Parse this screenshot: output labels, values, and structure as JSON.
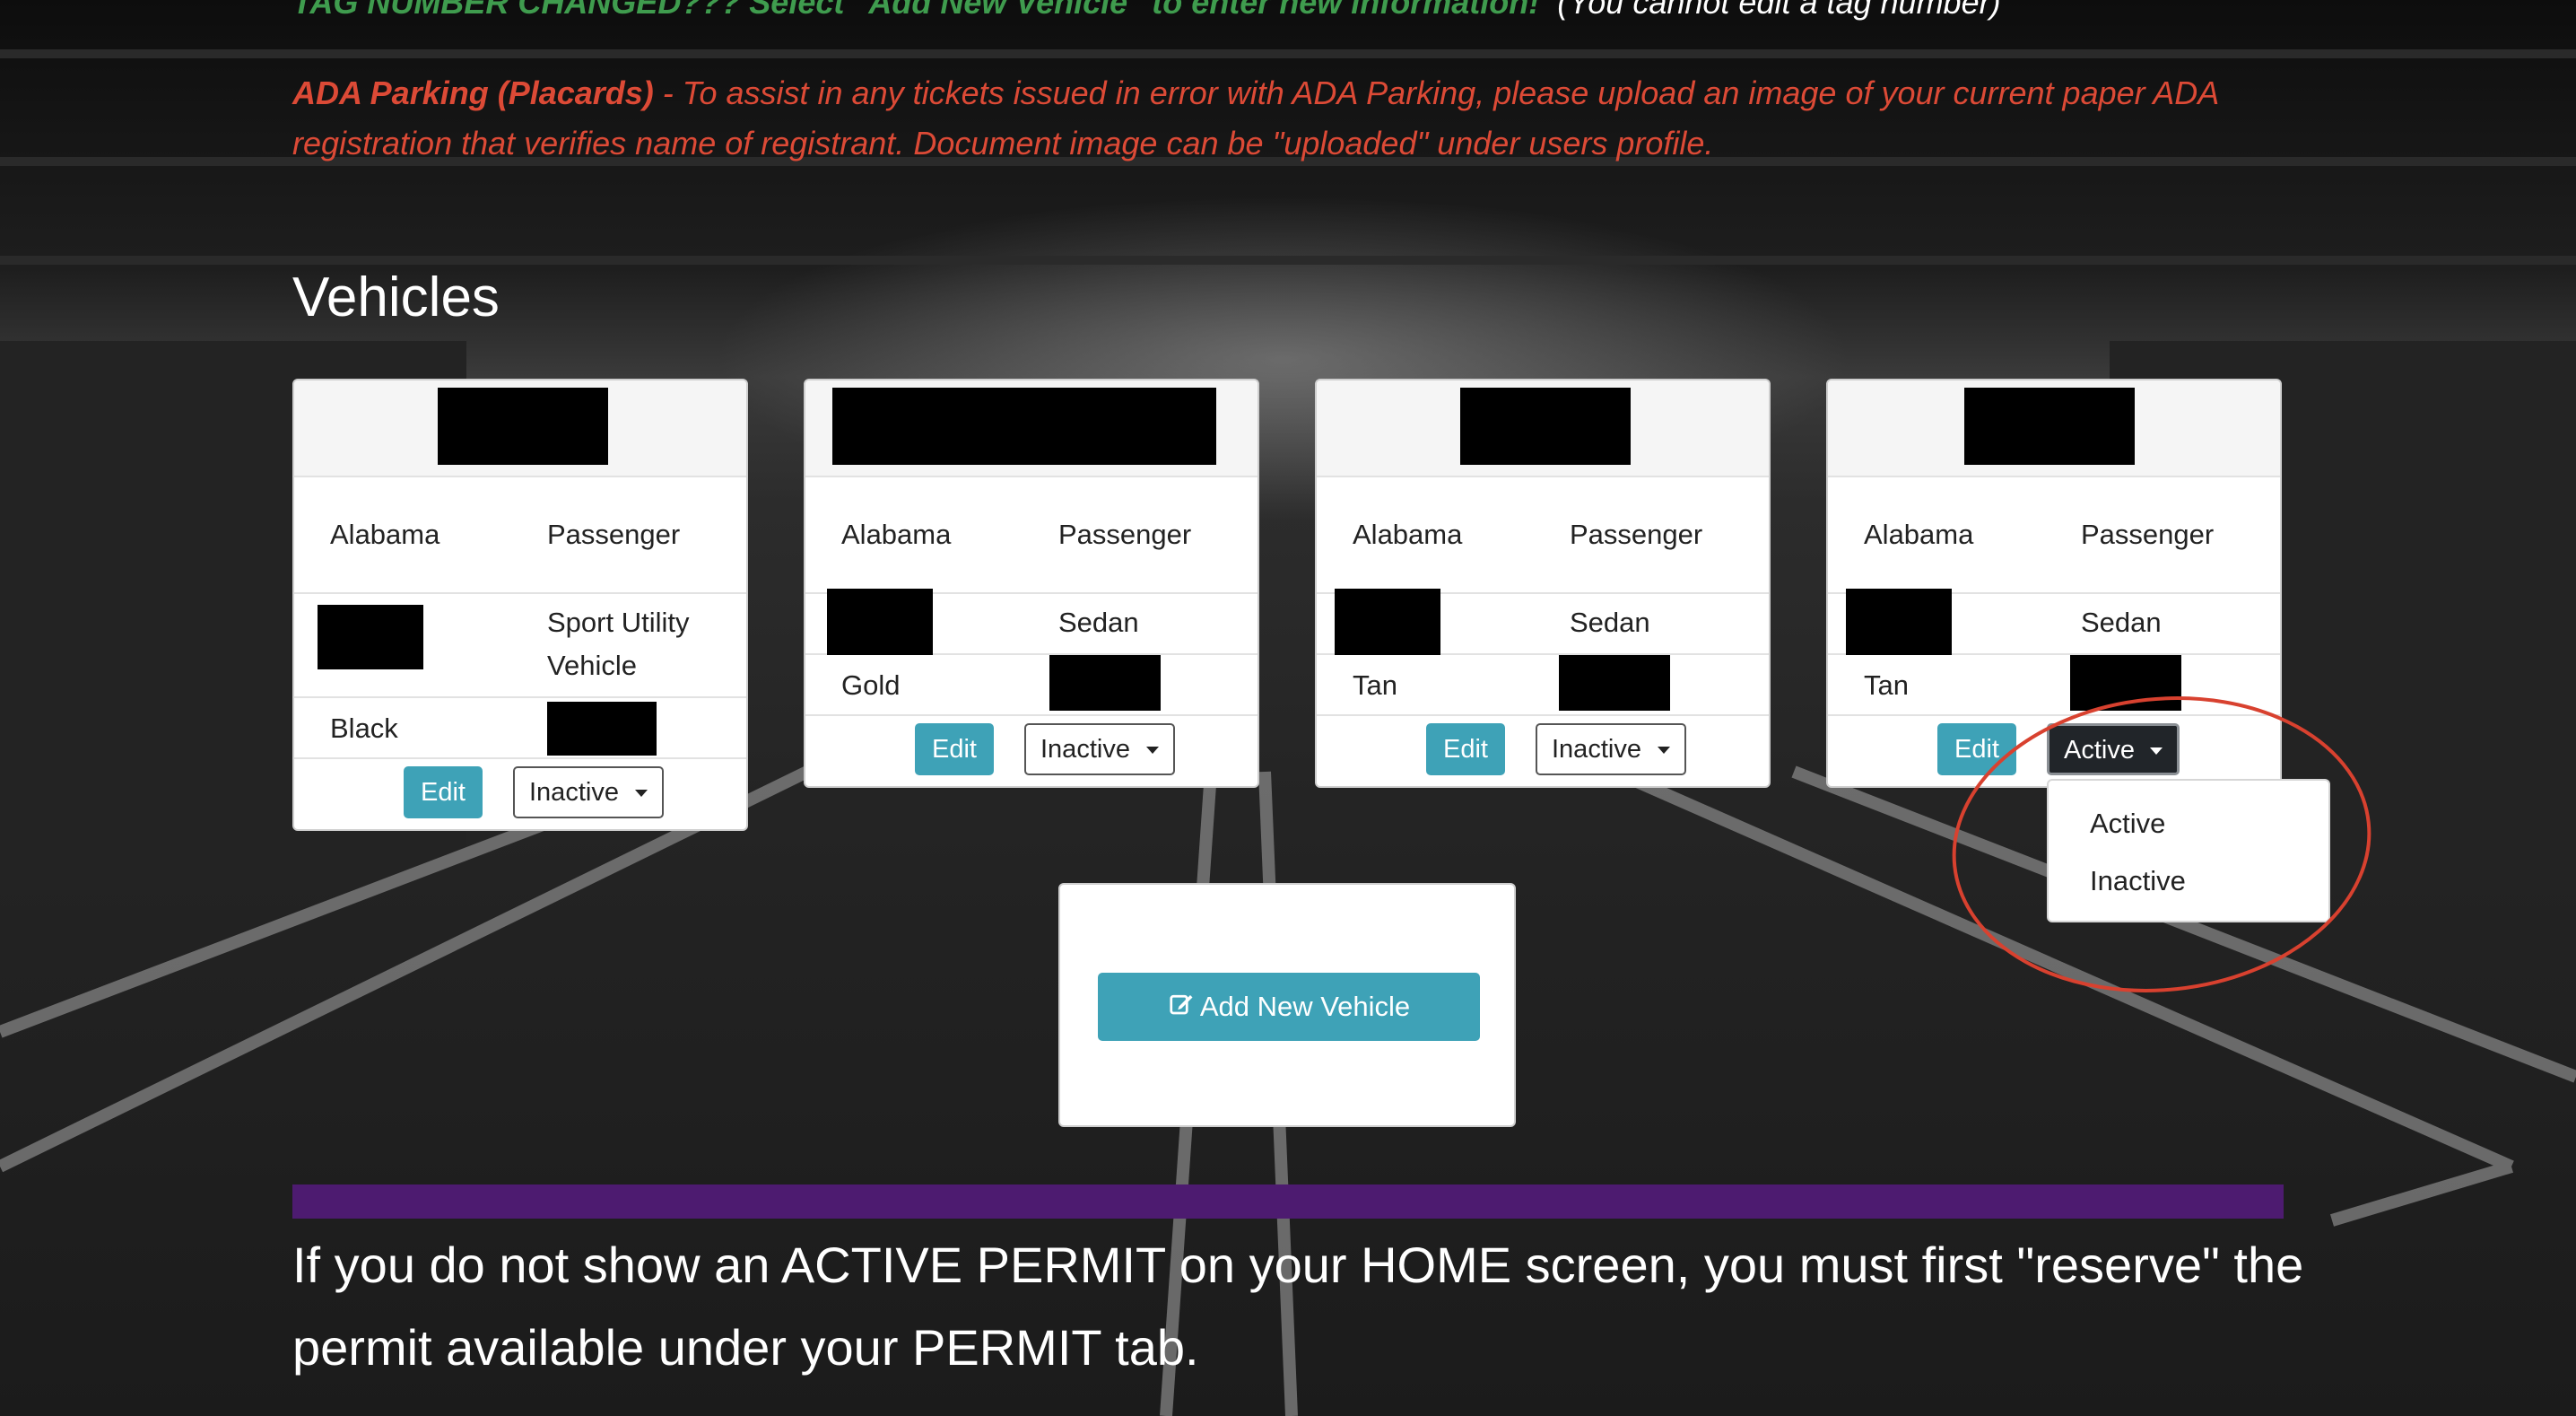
{
  "notices": {
    "tag_changed": "TAG NUMBER CHANGED???  Select \"Add New Vehicle\" to enter new information!",
    "tag_note": "(You cannot edit a tag number)",
    "ada_lead": "ADA Parking (Placards)",
    "ada_body": " - To assist in any tickets issued in error with ADA Parking, please upload an image of your current paper ADA registration that verifies name of registrant.  Document image can be \"uploaded\" under users profile."
  },
  "vehicles_section": {
    "title": "Vehicles",
    "cards": [
      {
        "state": "Alabama",
        "class": "Passenger",
        "type": "Sport Utility Vehicle",
        "color": "Black",
        "edit_label": "Edit",
        "status": "Inactive"
      },
      {
        "state": "Alabama",
        "class": "Passenger",
        "type": "Sedan",
        "color": "Gold",
        "edit_label": "Edit",
        "status": "Inactive"
      },
      {
        "state": "Alabama",
        "class": "Passenger",
        "type": "Sedan",
        "color": "Tan",
        "edit_label": "Edit",
        "status": "Inactive"
      },
      {
        "state": "Alabama",
        "class": "Passenger",
        "type": "Sedan",
        "color": "Tan",
        "edit_label": "Edit",
        "status": "Active"
      }
    ],
    "status_menu": {
      "options": [
        "Active",
        "Inactive"
      ]
    },
    "add_button": {
      "label": "Add New Vehicle",
      "icon": "edit-icon"
    }
  },
  "footer": {
    "message": "If you do not show an ACTIVE PERMIT on your HOME screen, you must first \"reserve\" the permit available under your PERMIT tab."
  },
  "colors": {
    "accent_teal": "#3ea2b7",
    "notice_green": "#3f9c4e",
    "notice_red": "#dc4a36",
    "bar_purple": "#4d1b70",
    "annotation_red": "#d8412f"
  }
}
